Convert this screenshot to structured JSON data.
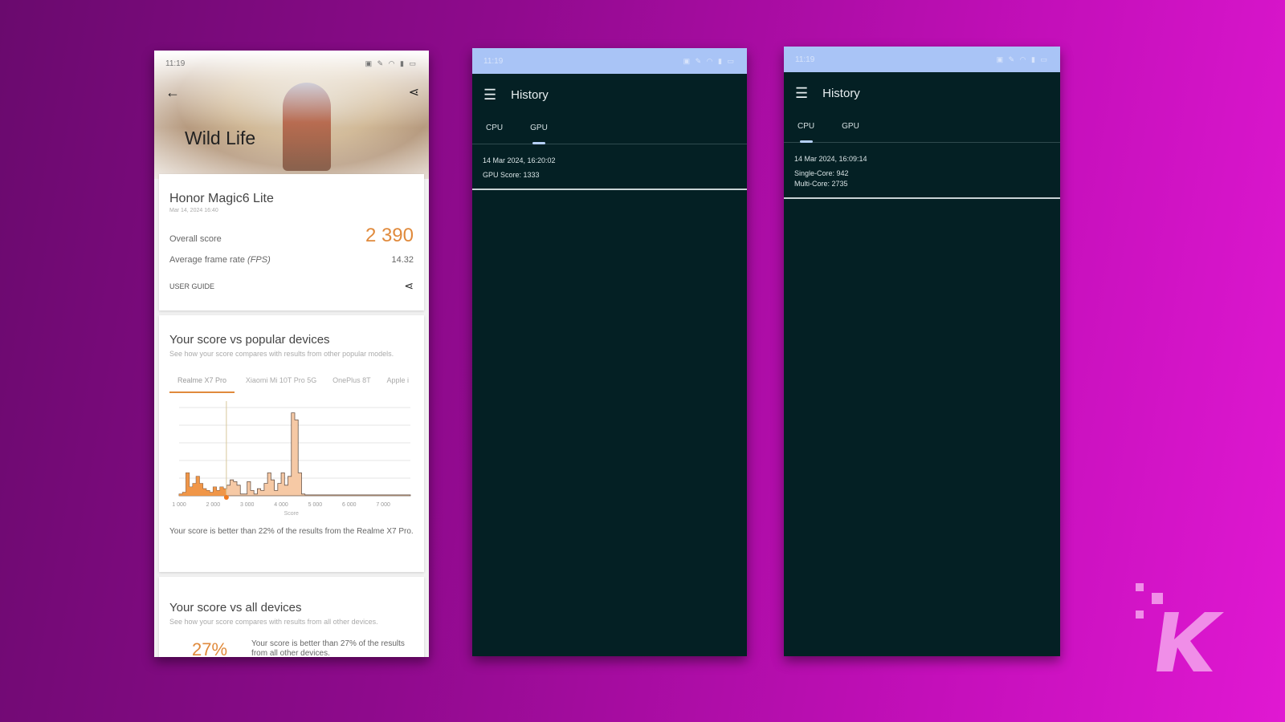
{
  "phone1": {
    "status": {
      "time": "11:19",
      "icons": "NFC mute wifi battery"
    },
    "header": {
      "title": "Wild Life",
      "back_icon": "arrow-left-icon",
      "share_icon": "share-icon"
    },
    "result": {
      "device": "Honor Magic6 Lite",
      "date": "Mar 14, 2024 16:40",
      "overall_label": "Overall score",
      "overall_value": "2 390",
      "fps_label": "Average frame rate",
      "fps_unit": "(FPS)",
      "fps_value": "14.32",
      "user_guide": "USER GUIDE"
    },
    "popular": {
      "title": "Your score vs popular devices",
      "subtitle": "See how your score compares with results from other popular models.",
      "tabs": [
        "Realme X7 Pro",
        "Xiaomi Mi 10T Pro 5G",
        "OnePlus 8T",
        "Apple i"
      ],
      "note": "Your score is better than 22% of the results from the Realme X7 Pro."
    },
    "all": {
      "title": "Your score vs all devices",
      "subtitle": "See how your score compares with results from all other devices.",
      "percent": "27%",
      "note": "Your score is better than 27% of the results from all other devices."
    }
  },
  "phone2": {
    "status": {
      "time": "11:19"
    },
    "title": "History",
    "tabs": [
      "CPU",
      "GPU"
    ],
    "active_tab": "GPU",
    "entry": {
      "date": "14 Mar 2024, 16:20:02",
      "line1": "GPU Score: 1333"
    }
  },
  "phone3": {
    "status": {
      "time": "11:19"
    },
    "title": "History",
    "tabs": [
      "CPU",
      "GPU"
    ],
    "active_tab": "CPU",
    "entry": {
      "date": "14 Mar 2024, 16:09:14",
      "line1": "Single-Core: 942",
      "line2": "Multi-Core: 2735"
    }
  },
  "colors": {
    "accent": "#e08a3c",
    "dark_bg": "#042024",
    "status_bar": "#a9c4f6",
    "logo": "#f08ee8"
  },
  "chart_data": {
    "type": "area",
    "xlabel": "Score",
    "xticks": [
      "1 000",
      "2 000",
      "3 000",
      "4 000",
      "5 000",
      "6 000",
      "7 000"
    ],
    "xlim": [
      1000,
      7800
    ],
    "your_score": 2390,
    "x": [
      1000,
      1100,
      1200,
      1300,
      1400,
      1500,
      1600,
      1700,
      1800,
      1900,
      2000,
      2100,
      2200,
      2300,
      2400,
      2500,
      2600,
      2700,
      2800,
      2900,
      3000,
      3100,
      3200,
      3300,
      3400,
      3500,
      3600,
      3700,
      3800,
      3900,
      4000,
      4100,
      4200,
      4300,
      4400,
      4500,
      4600,
      4700,
      5000,
      6000,
      7000,
      7800
    ],
    "values": [
      0.1,
      0.2,
      1.3,
      0.5,
      0.7,
      1.1,
      0.7,
      0.4,
      0.3,
      0.2,
      0.5,
      0.3,
      0.5,
      0.4,
      0.6,
      0.9,
      0.8,
      0.6,
      0.1,
      0.1,
      0.8,
      0.3,
      0.1,
      0.4,
      0.3,
      0.7,
      1.3,
      0.9,
      0.3,
      0.7,
      1.3,
      0.6,
      1.1,
      4.7,
      4.3,
      1.3,
      0.1,
      0.05,
      0.05,
      0.05,
      0.05,
      0.05
    ],
    "ylim": [
      0,
      5
    ],
    "grid": true
  }
}
